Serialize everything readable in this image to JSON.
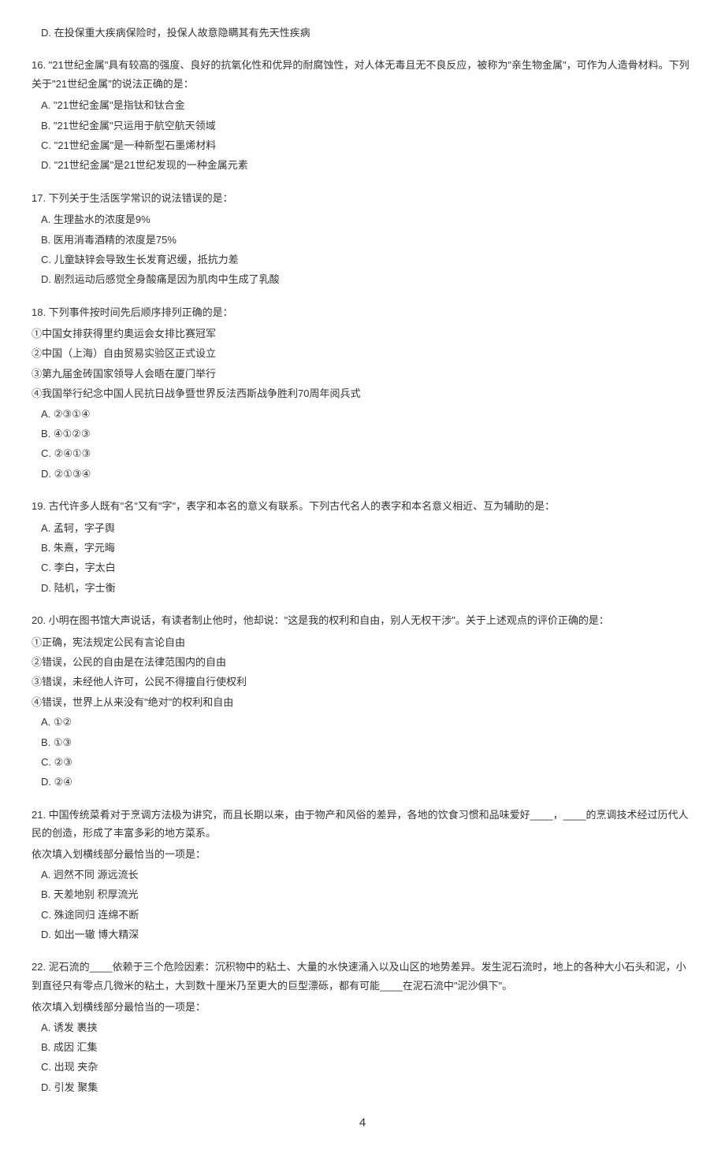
{
  "topOption": "D. 在投保重大疾病保险时，投保人故意隐瞒其有先天性疾病",
  "questions": [
    {
      "num": "16.",
      "stem": "\"21世纪金属\"具有较高的强度、良好的抗氧化性和优异的耐腐蚀性，对人体无毒且无不良反应，被称为\"亲生物金属\"，可作为人造骨材料。下列关于\"21世纪金属\"的说法正确的是：",
      "sublines": [],
      "options": [
        "A. \"21世纪金属\"是指钛和钛合金",
        "B. \"21世纪金属\"只运用于航空航天领域",
        "C. \"21世纪金属\"是一种新型石墨烯材料",
        "D. \"21世纪金属\"是21世纪发现的一种金属元素"
      ]
    },
    {
      "num": "17.",
      "stem": "下列关于生活医学常识的说法错误的是：",
      "sublines": [],
      "options": [
        "A. 生理盐水的浓度是9%",
        "B. 医用消毒酒精的浓度是75%",
        "C. 儿童缺锌会导致生长发育迟缓，抵抗力差",
        "D. 剧烈运动后感觉全身酸痛是因为肌肉中生成了乳酸"
      ]
    },
    {
      "num": "18.",
      "stem": "下列事件按时间先后顺序排列正确的是：",
      "sublines": [
        "①中国女排获得里约奥运会女排比赛冠军",
        "②中国（上海）自由贸易实验区正式设立",
        "③第九届金砖国家领导人会晤在厦门举行",
        "④我国举行纪念中国人民抗日战争暨世界反法西斯战争胜利70周年阅兵式"
      ],
      "options": [
        "A. ②③①④",
        "B. ④①②③",
        "C. ②④①③",
        "D. ②①③④"
      ]
    },
    {
      "num": "19.",
      "stem": "古代许多人既有\"名\"又有\"字\"，表字和本名的意义有联系。下列古代名人的表字和本名意义相近、互为辅助的是：",
      "sublines": [],
      "options": [
        "A. 孟轲，字子舆",
        "B. 朱熹，字元晦",
        "C. 李白，字太白",
        "D. 陆机，字士衡"
      ]
    },
    {
      "num": "20.",
      "stem": "小明在图书馆大声说话，有读者制止他时，他却说：\"这是我的权利和自由，别人无权干涉\"。关于上述观点的评价正确的是：",
      "sublines": [
        "①正确，宪法规定公民有言论自由",
        "②错误，公民的自由是在法律范围内的自由",
        "③错误，未经他人许可，公民不得擅自行使权利",
        "④错误，世界上从来没有\"绝对\"的权利和自由"
      ],
      "options": [
        "A. ①②",
        "B. ①③",
        "C. ②③",
        "D. ②④"
      ]
    },
    {
      "num": "21.",
      "stem": "中国传统菜肴对于烹调方法极为讲究，而且长期以来，由于物产和风俗的差异，各地的饮食习惯和品味爱好____，____的烹调技术经过历代人民的创造，形成了丰富多彩的地方菜系。",
      "sublines": [
        "依次填入划横线部分最恰当的一项是："
      ],
      "options": [
        "A. 迥然不同 源远流长",
        "B. 天差地别 积厚流光",
        "C. 殊途同归 连绵不断",
        "D. 如出一辙 博大精深"
      ]
    },
    {
      "num": "22.",
      "stem": "泥石流的____依赖于三个危险因素：沉积物中的粘土、大量的水快速涌入以及山区的地势差异。发生泥石流时，地上的各种大小石头和泥，小到直径只有零点几微米的粘土，大到数十厘米乃至更大的巨型漂砾，都有可能____在泥石流中\"泥沙俱下\"。",
      "sublines": [
        "依次填入划横线部分最恰当的一项是："
      ],
      "options": [
        "A. 诱发 裹挟",
        "B. 成因 汇集",
        "C. 出现 夹杂",
        "D. 引发 聚集"
      ]
    }
  ],
  "pageNum": "4"
}
